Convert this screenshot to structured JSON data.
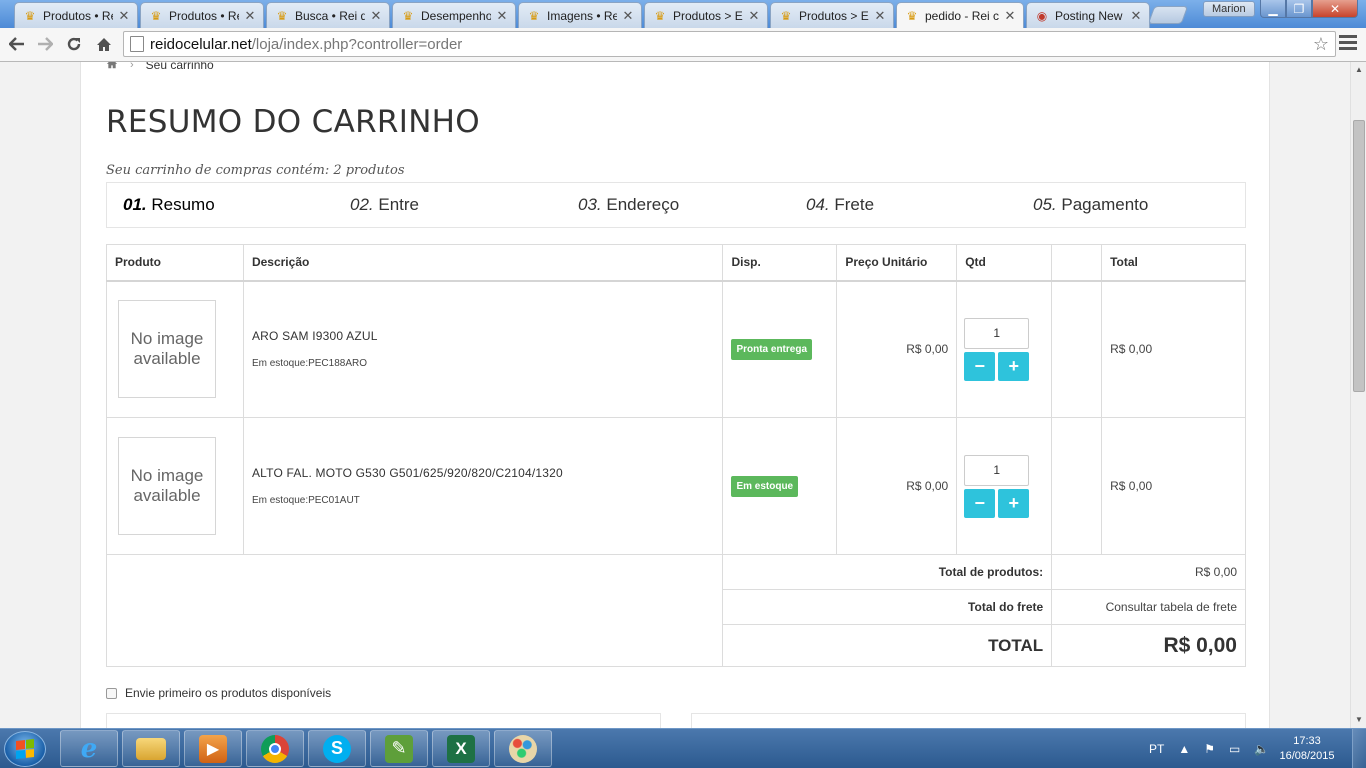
{
  "browser": {
    "tabs": [
      {
        "title": "Produtos • Re",
        "icon": "crown-favicon-icon"
      },
      {
        "title": "Produtos • Re",
        "icon": "crown-favicon-icon"
      },
      {
        "title": "Busca • Rei d",
        "icon": "crown-favicon-icon"
      },
      {
        "title": "Desempenho",
        "icon": "crown-favicon-icon"
      },
      {
        "title": "Imagens • Rei",
        "icon": "crown-favicon-icon"
      },
      {
        "title": "Produtos > E",
        "icon": "crown-favicon-icon"
      },
      {
        "title": "Produtos > E",
        "icon": "crown-favicon-icon"
      },
      {
        "title": "pedido - Rei c",
        "icon": "crown-favicon-icon",
        "active": true
      },
      {
        "title": "Posting New",
        "icon": "forum-favicon-icon"
      }
    ],
    "profile_name": "Marion",
    "url_host": "reidocelular.net",
    "url_path": "/loja/index.php?controller=order"
  },
  "page": {
    "breadcrumb": {
      "current": "Seu carrinho"
    },
    "heading": "RESUMO DO CARRINHO",
    "cart_summary": "Seu carrinho de compras contém: 2 produtos",
    "steps": [
      {
        "num": "01.",
        "label": "Resumo",
        "current": true
      },
      {
        "num": "02.",
        "label": "Entre"
      },
      {
        "num": "03.",
        "label": "Endereço"
      },
      {
        "num": "04.",
        "label": "Frete"
      },
      {
        "num": "05.",
        "label": "Pagamento"
      }
    ],
    "table": {
      "headers": {
        "product": "Produto",
        "description": "Descrição",
        "availability": "Disp.",
        "unit_price": "Preço Unitário",
        "qty": "Qtd",
        "blank": "",
        "total": "Total"
      },
      "rows": [
        {
          "image_text": "No image available",
          "name": "ARO SAM I9300 AZUL",
          "ref": "Em estoque:PEC188ARO",
          "availability": "Pronta entrega",
          "availability_color": "#5cb85c",
          "unit_price": "R$ 0,00",
          "qty": "1",
          "total": "R$ 0,00"
        },
        {
          "image_text": "No image available",
          "name": "ALTO FAL. MOTO G530 G501/625/920/820/C2104/1320",
          "ref": "Em estoque:PEC01AUT",
          "availability": "Em estoque",
          "availability_color": "#5cb85c",
          "unit_price": "R$ 0,00",
          "qty": "1",
          "total": "R$ 0,00"
        }
      ],
      "qty_minus": "−",
      "qty_plus": "+",
      "qty_button_color": "#2ec3dc",
      "totals": {
        "products_label": "Total de produtos:",
        "products_value": "R$ 0,00",
        "shipping_label": "Total do frete",
        "shipping_value": "Consultar tabela de frete",
        "total_label": "TOTAL",
        "total_value": "R$ 0,00"
      }
    },
    "option_label": "Envie primeiro os produtos disponíveis"
  },
  "taskbar": {
    "apps": [
      "internet-explorer-icon",
      "file-explorer-icon",
      "media-player-icon",
      "chrome-icon",
      "skype-icon",
      "vector-drawing-icon",
      "excel-icon",
      "paint-icon"
    ],
    "language": "PT",
    "time": "17:33",
    "date": "16/08/2015"
  }
}
